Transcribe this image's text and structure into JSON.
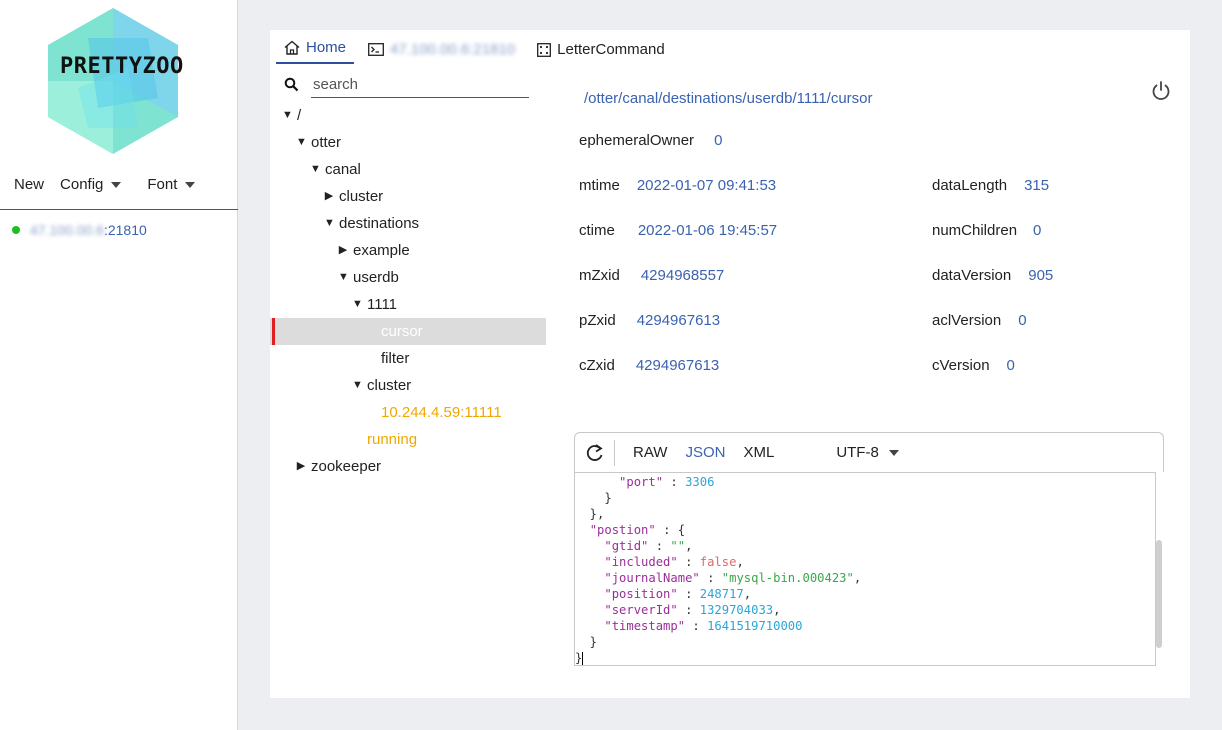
{
  "app": {
    "logo_text": "PRETTYZOO"
  },
  "sidebar": {
    "menu": [
      {
        "label": "New",
        "has_dropdown": false
      },
      {
        "label": "Config",
        "has_dropdown": true
      },
      {
        "label": "Font",
        "has_dropdown": true
      }
    ],
    "servers": [
      {
        "label_hidden": "47.100.00.6",
        "label_port": ":21810",
        "status_color": "#1fbf1f"
      }
    ]
  },
  "tabs": [
    {
      "label": "Home",
      "icon": "home-icon",
      "active": true
    },
    {
      "label": "47.100.00.6:21810",
      "icon": "terminal-icon",
      "active": false
    },
    {
      "label": "LetterCommand",
      "icon": "dice-icon",
      "active": false
    }
  ],
  "search": {
    "placeholder": "search"
  },
  "tree": [
    {
      "label": "/",
      "depth": 0,
      "expanded": true
    },
    {
      "label": "otter",
      "depth": 1,
      "expanded": true
    },
    {
      "label": "canal",
      "depth": 2,
      "expanded": true
    },
    {
      "label": "cluster",
      "depth": 3,
      "expanded": false
    },
    {
      "label": "destinations",
      "depth": 3,
      "expanded": true
    },
    {
      "label": "example",
      "depth": 4,
      "expanded": false
    },
    {
      "label": "userdb",
      "depth": 4,
      "expanded": true
    },
    {
      "label": "1111",
      "depth": 5,
      "expanded": true
    },
    {
      "label": "cursor",
      "depth": 6,
      "leaf": true,
      "selected": true
    },
    {
      "label": "filter",
      "depth": 6,
      "leaf": true
    },
    {
      "label": "cluster",
      "depth": 5,
      "expanded": true
    },
    {
      "label": "10.244.4.59:11111",
      "depth": 6,
      "leaf": true,
      "ephemeral": true
    },
    {
      "label": "running",
      "depth": 5,
      "leaf": true,
      "ephemeral": true
    },
    {
      "label": "zookeeper",
      "depth": 1,
      "expanded": false
    }
  ],
  "node": {
    "path": "/otter/canal/destinations/userdb/1111/cursor",
    "ephemeralOwner": {
      "label": "ephemeralOwner",
      "value": "0"
    },
    "mtime": {
      "label": "mtime",
      "value": "2022-01-07 09:41:53"
    },
    "ctime": {
      "label": "ctime",
      "value": "2022-01-06 19:45:57"
    },
    "mZxid": {
      "label": "mZxid",
      "value": "4294968557"
    },
    "pZxid": {
      "label": "pZxid",
      "value": "4294967613"
    },
    "cZxid": {
      "label": "cZxid",
      "value": "4294967613"
    },
    "dataLength": {
      "label": "dataLength",
      "value": "315"
    },
    "numChildren": {
      "label": "numChildren",
      "value": "0"
    },
    "dataVersion": {
      "label": "dataVersion",
      "value": "905"
    },
    "aclVersion": {
      "label": "aclVersion",
      "value": "0"
    },
    "cVersion": {
      "label": "cVersion",
      "value": "0"
    }
  },
  "editor": {
    "formats": [
      "RAW",
      "JSON",
      "XML"
    ],
    "active_format": "JSON",
    "encoding": "UTF-8",
    "lines": [
      [
        [
          "p",
          "      "
        ],
        [
          "k",
          "\"port\""
        ],
        [
          "p",
          " : "
        ],
        [
          "n",
          "3306"
        ]
      ],
      [
        [
          "p",
          "    }"
        ]
      ],
      [
        [
          "p",
          "  },"
        ]
      ],
      [
        [
          "p",
          "  "
        ],
        [
          "k",
          "\"postion\""
        ],
        [
          "p",
          " : {"
        ]
      ],
      [
        [
          "p",
          "    "
        ],
        [
          "k",
          "\"gtid\""
        ],
        [
          "p",
          " : "
        ],
        [
          "s",
          "\"\""
        ],
        [
          "p",
          ","
        ]
      ],
      [
        [
          "p",
          "    "
        ],
        [
          "k",
          "\"included\""
        ],
        [
          "p",
          " : "
        ],
        [
          "b",
          "false"
        ],
        [
          "p",
          ","
        ]
      ],
      [
        [
          "p",
          "    "
        ],
        [
          "k",
          "\"journalName\""
        ],
        [
          "p",
          " : "
        ],
        [
          "s",
          "\"mysql-bin.000423\""
        ],
        [
          "p",
          ","
        ]
      ],
      [
        [
          "p",
          "    "
        ],
        [
          "k",
          "\"position\""
        ],
        [
          "p",
          " : "
        ],
        [
          "n",
          "248717"
        ],
        [
          "p",
          ","
        ]
      ],
      [
        [
          "p",
          "    "
        ],
        [
          "k",
          "\"serverId\""
        ],
        [
          "p",
          " : "
        ],
        [
          "n",
          "1329704033"
        ],
        [
          "p",
          ","
        ]
      ],
      [
        [
          "p",
          "    "
        ],
        [
          "k",
          "\"timestamp\""
        ],
        [
          "p",
          " : "
        ],
        [
          "n",
          "1641519710000"
        ]
      ],
      [
        [
          "p",
          "  }"
        ]
      ],
      [
        [
          "p",
          "}"
        ]
      ]
    ]
  }
}
